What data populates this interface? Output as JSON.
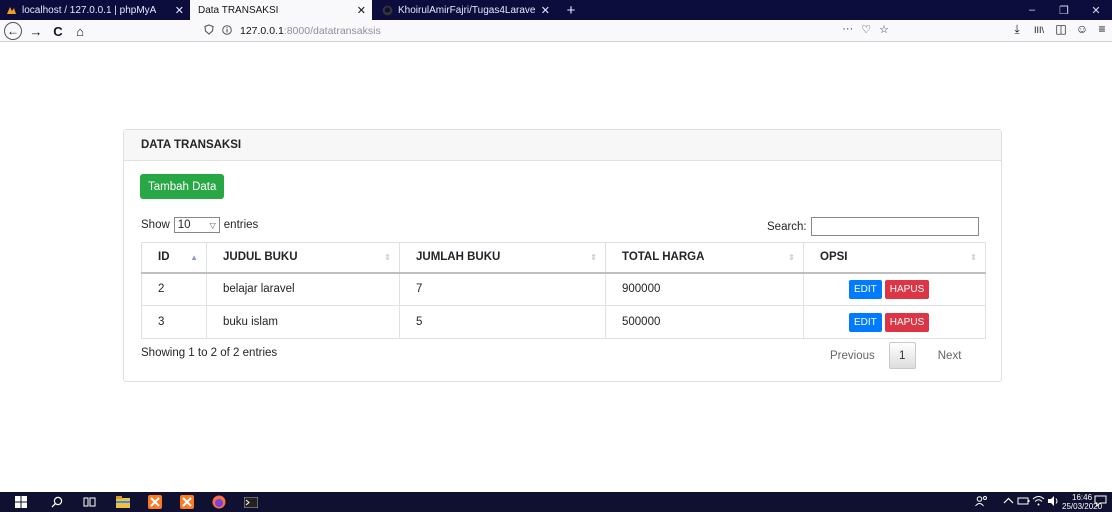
{
  "tabs": [
    {
      "title": "localhost / 127.0.0.1 | phpMyA",
      "close": "✕"
    },
    {
      "title": "Data TRANSAKSI",
      "close": "✕"
    },
    {
      "title": "KhoirulAmirFajri/Tugas4Larave",
      "close": "✕"
    }
  ],
  "new_tab": "+",
  "window": {
    "minimize": "–",
    "restore": "❐",
    "close": "✕"
  },
  "nav": {
    "back": "←",
    "forward": "→",
    "reload": "C",
    "home": "⌂"
  },
  "url": {
    "host": "127.0.0.1",
    "path": ":8000/datatransaksis",
    "more": "···",
    "pocket": "♡",
    "bookmark": "☆"
  },
  "toolbar": {
    "download": "⤓",
    "library": "III\\",
    "sidebar": "◫",
    "account": "☺",
    "menu": "≡"
  },
  "card": {
    "title": "DATA TRANSAKSI",
    "add_button": "Tambah Data",
    "length": {
      "show": "Show",
      "value": "10",
      "entries": "entries"
    },
    "search_label": "Search:",
    "search_value": "",
    "columns": [
      "ID",
      "JUDUL BUKU",
      "JUMLAH BUKU",
      "TOTAL HARGA",
      "OPSI"
    ],
    "rows": [
      {
        "id": "2",
        "judul": "belajar laravel",
        "jumlah": "7",
        "total": "900000"
      },
      {
        "id": "3",
        "judul": "buku islam",
        "jumlah": "5",
        "total": "500000"
      }
    ],
    "edit_label": "EDIT",
    "hapus_label": "HAPUS",
    "info": "Showing 1 to 2 of 2 entries",
    "pager": {
      "previous": "Previous",
      "page": "1",
      "next": "Next"
    }
  },
  "taskbar": {
    "clock_time": "16:46",
    "clock_date": "25/03/2020"
  },
  "colors": {
    "add": "#28a745",
    "edit": "#007bff",
    "hapus": "#dc3545",
    "titlebar": "#0c0c3d"
  }
}
